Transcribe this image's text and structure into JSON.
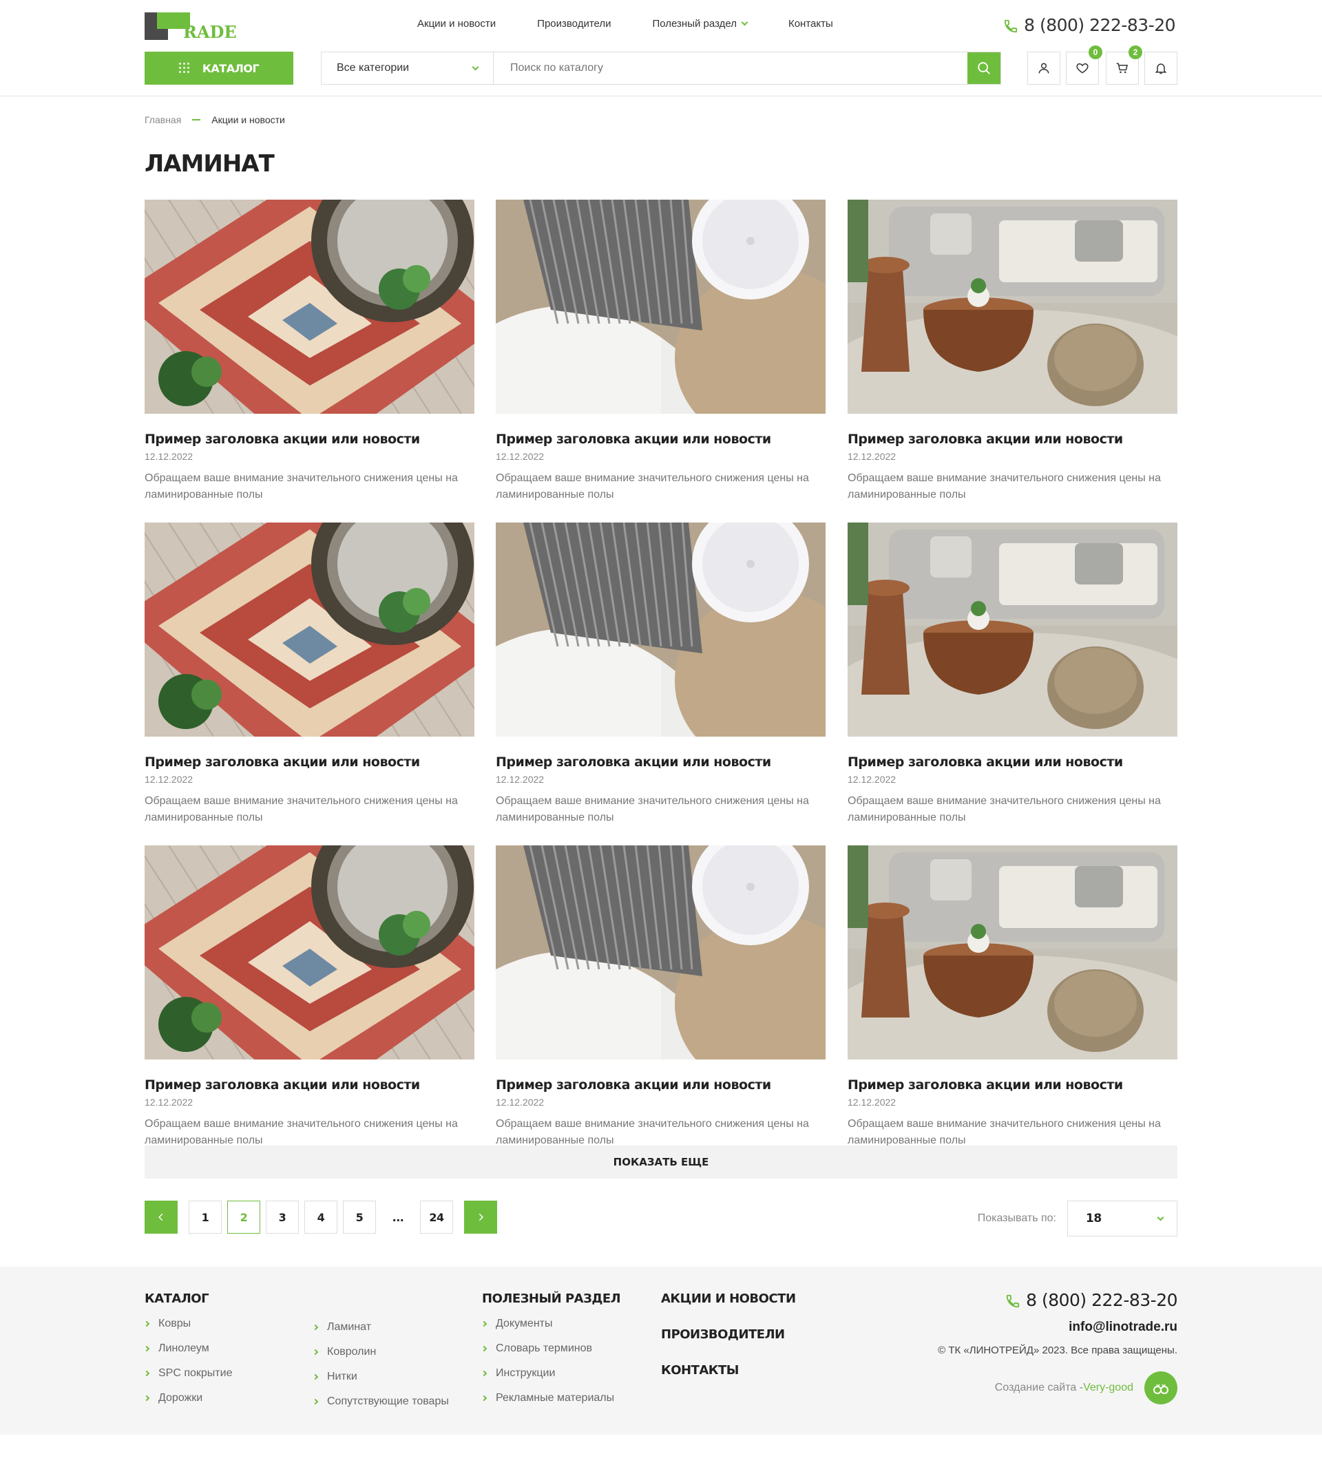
{
  "header": {
    "logo_text": "RADE",
    "nav": [
      {
        "label": "Акции и новости"
      },
      {
        "label": "Производители"
      },
      {
        "label": "Полезный раздел",
        "has_dropdown": true
      },
      {
        "label": "Контакты"
      }
    ],
    "phone": "8 (800) 222-83-20",
    "catalog_label": "КАТАЛОГ",
    "category_select": "Все категории",
    "search_placeholder": "Поиск по каталогу",
    "wishlist_count": "0",
    "cart_count": "2"
  },
  "breadcrumb": {
    "home": "Главная",
    "current": "Акции и новости"
  },
  "page_title": "ЛАМИНАТ",
  "cards": [
    {
      "image": "rug-image",
      "title": "Пример заголовка акции или новости",
      "date": "12.12.2022",
      "desc": "Обращаем ваше внимание значительного снижения цены на ламинированные полы"
    },
    {
      "image": "pillow-image",
      "title": "Пример заголовка акции или новости",
      "date": "12.12.2022",
      "desc": "Обращаем ваше внимание значительного снижения цены на ламинированные полы"
    },
    {
      "image": "sofa-image",
      "title": "Пример заголовка акции или новости",
      "date": "12.12.2022",
      "desc": "Обращаем ваше внимание значительного снижения цены на ламинированные полы"
    },
    {
      "image": "rug-image",
      "title": "Пример заголовка акции или новости",
      "date": "12.12.2022",
      "desc": "Обращаем ваше внимание значительного снижения цены на ламинированные полы"
    },
    {
      "image": "pillow-image",
      "title": "Пример заголовка акции или новости",
      "date": "12.12.2022",
      "desc": "Обращаем ваше внимание значительного снижения цены на ламинированные полы"
    },
    {
      "image": "sofa-image",
      "title": "Пример заголовка акции или новости",
      "date": "12.12.2022",
      "desc": "Обращаем ваше внимание значительного снижения цены на ламинированные полы"
    },
    {
      "image": "rug-image",
      "title": "Пример заголовка акции или новости",
      "date": "12.12.2022",
      "desc": "Обращаем ваше внимание значительного снижения цены на ламинированные полы"
    },
    {
      "image": "pillow-image",
      "title": "Пример заголовка акции или новости",
      "date": "12.12.2022",
      "desc": "Обращаем ваше внимание значительного снижения цены на ламинированные полы"
    },
    {
      "image": "sofa-image",
      "title": "Пример заголовка акции или новости",
      "date": "12.12.2022",
      "desc": "Обращаем ваше внимание значительного снижения цены на ламинированные полы"
    }
  ],
  "show_more": "ПОКАЗАТЬ ЕЩЕ",
  "pagination": {
    "pages": [
      "1",
      "2",
      "3",
      "4",
      "5",
      "...",
      "24"
    ],
    "active": "2",
    "per_page_label": "Показывать по:",
    "per_page_value": "18"
  },
  "footer": {
    "catalog_heading": "КАТАЛОГ",
    "catalog_col1": [
      "Ковры",
      "Линолеум",
      "SPC покрытие",
      "Дорожки"
    ],
    "catalog_col2": [
      "Ламинат",
      "Ковролин",
      "Нитки",
      "Сопутствующие товары"
    ],
    "useful_heading": "ПОЛЕЗНЫЙ РАЗДЕЛ",
    "useful_items": [
      "Документы",
      "Словарь терминов",
      "Инструкции",
      "Рекламные материалы"
    ],
    "links": [
      "АКЦИИ И НОВОСТИ",
      "ПРОИЗВОДИТЕЛИ",
      "КОНТАКТЫ"
    ],
    "phone": "8 (800) 222-83-20",
    "email": "info@linotrade.ru",
    "copyright": "© ТК «ЛИНОТРЕЙД» 2023. Все права защищены.",
    "made_by_prefix": "Создание сайта -",
    "made_by_brand": "Very-good"
  },
  "colors": {
    "accent": "#6fbd3d",
    "text": "#222222",
    "muted": "#888888",
    "footer_bg": "#f5f5f5"
  }
}
